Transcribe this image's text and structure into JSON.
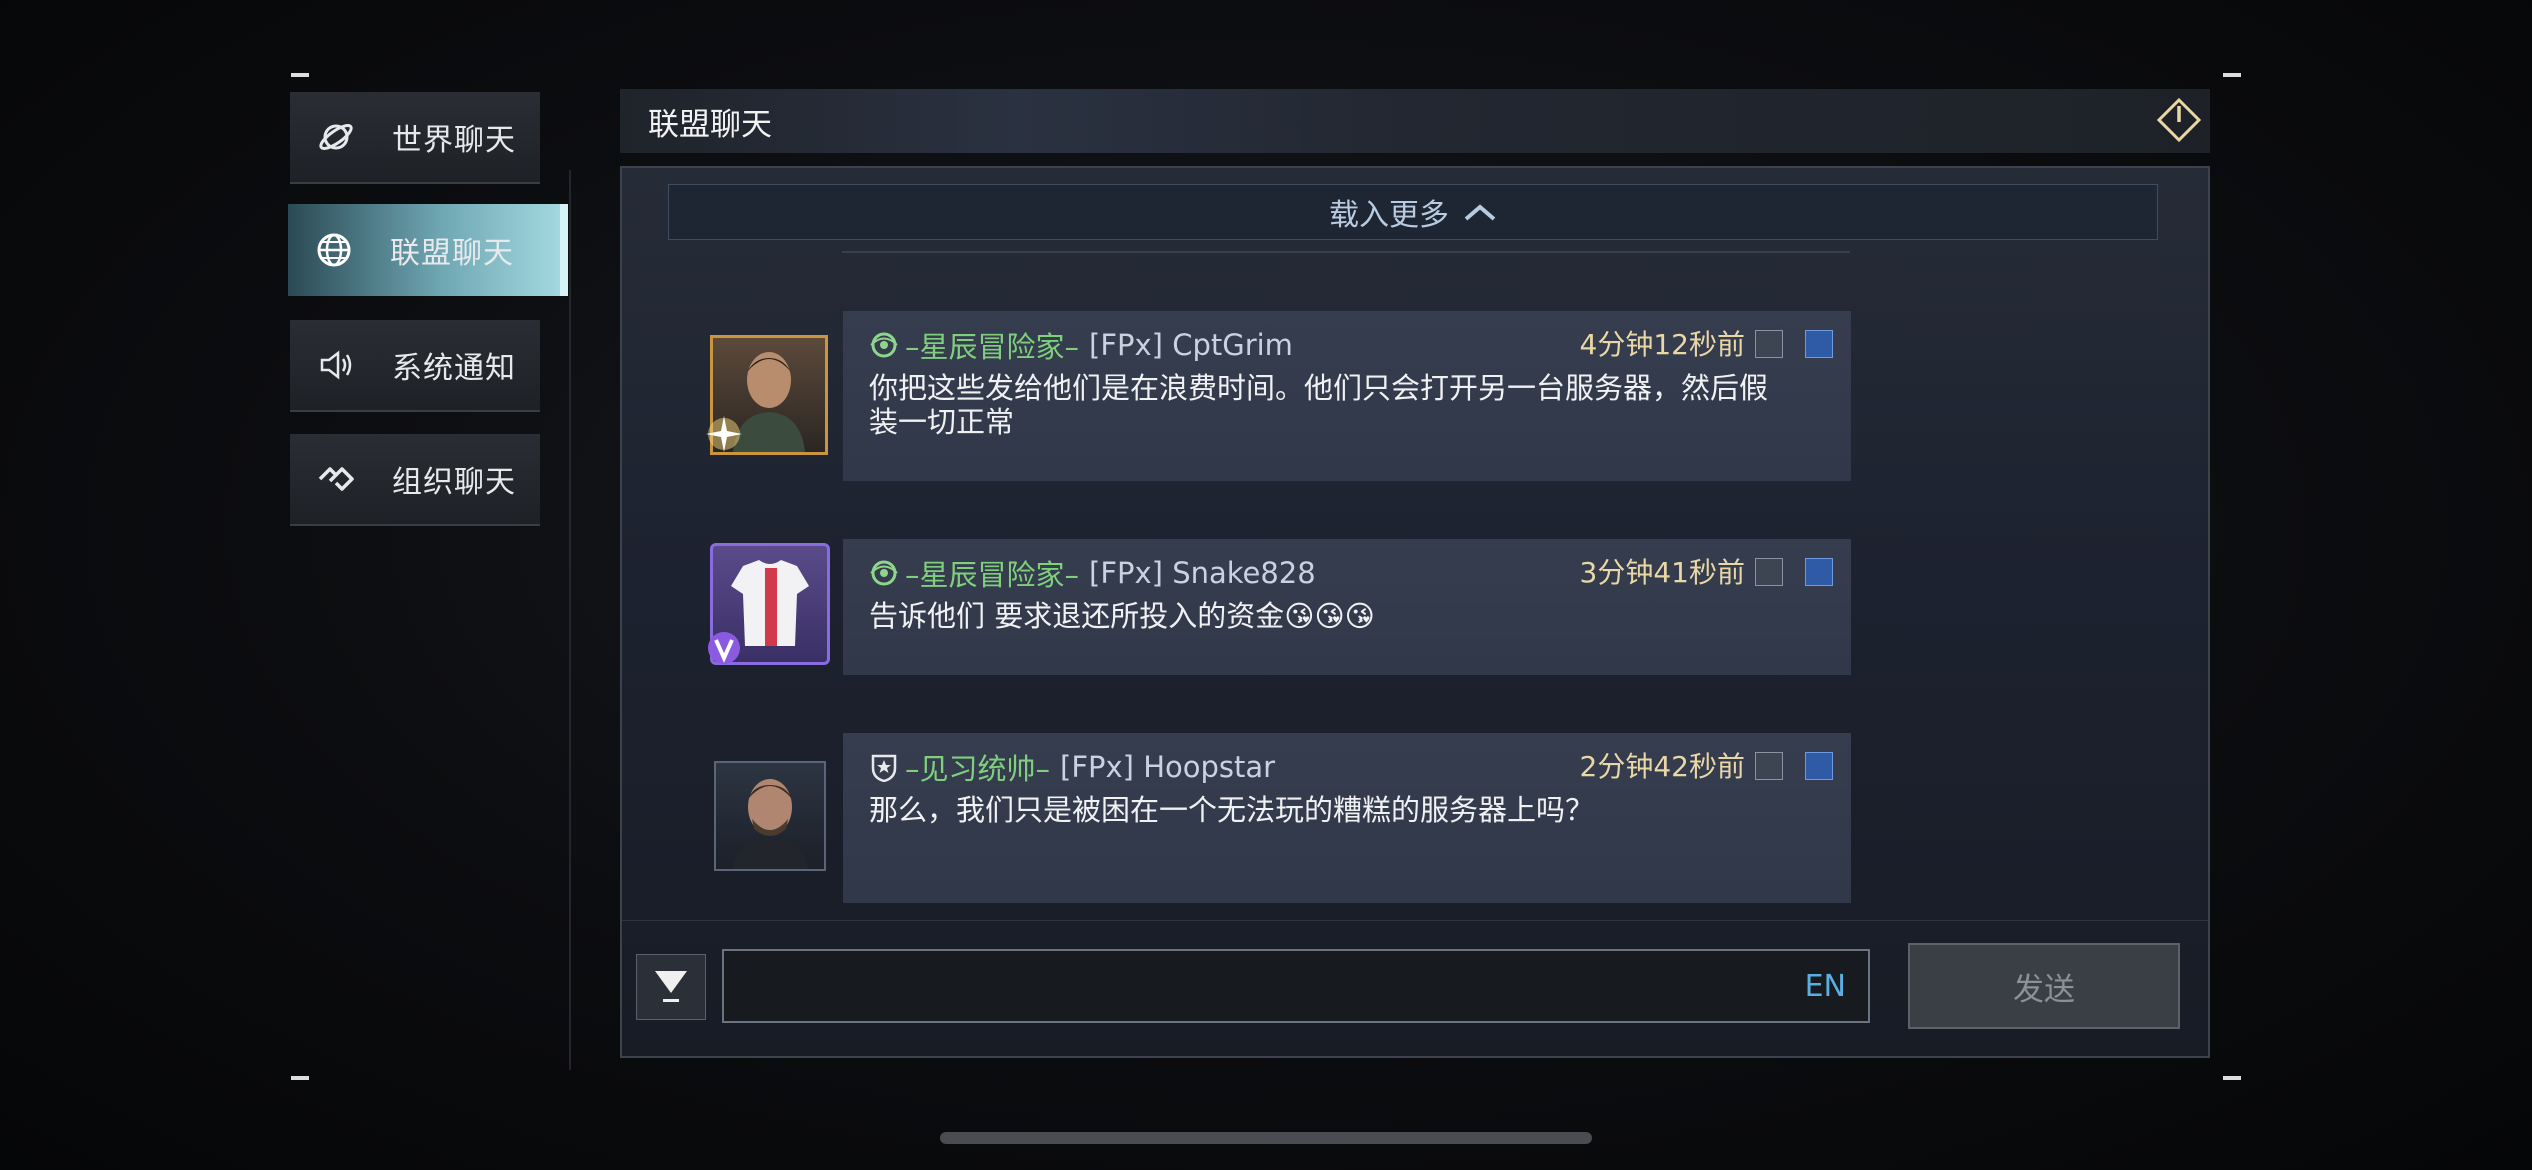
{
  "sidebar": {
    "items": [
      {
        "label": "世界聊天",
        "icon": "planet-icon",
        "active": false
      },
      {
        "label": "联盟聊天",
        "icon": "globe-icon",
        "active": true
      },
      {
        "label": "系统通知",
        "icon": "speaker-icon",
        "active": false
      },
      {
        "label": "组织聊天",
        "icon": "organization-icon",
        "active": false
      }
    ]
  },
  "header": {
    "title": "联盟聊天",
    "exit_icon": "exit-icon"
  },
  "chat": {
    "load_more": "载入更多",
    "messages": [
      {
        "rank": "–星辰冒险家–",
        "name": "[FPx] CptGrim",
        "time": "4分钟12秒前",
        "text": "你把这些发给他们是在浪费时间。他们只会打开另一台服务器，然后假装一切正常",
        "avatar": "portrait-avatar-gold-frame"
      },
      {
        "rank": "–星辰冒险家–",
        "name": "[FPx] Snake828",
        "time": "3分钟41秒前",
        "text": "告诉他们 要求退还所投入的资金😘😘😘",
        "avatar": "jersey-avatar-purple-frame"
      },
      {
        "rank": "–见习统帅–",
        "name": "[FPx] Hoopstar",
        "time": "2分钟42秒前",
        "text": "那么，我们只是被困在一个无法玩的糟糕的服务器上吗？",
        "avatar": "portrait-avatar-plain-frame"
      }
    ]
  },
  "input": {
    "lang": "EN",
    "value": ""
  },
  "send_label": "发送",
  "colors": {
    "rank": "#7fcf7d",
    "time": "#e9d7a6",
    "accent": "#a6dbe2"
  }
}
